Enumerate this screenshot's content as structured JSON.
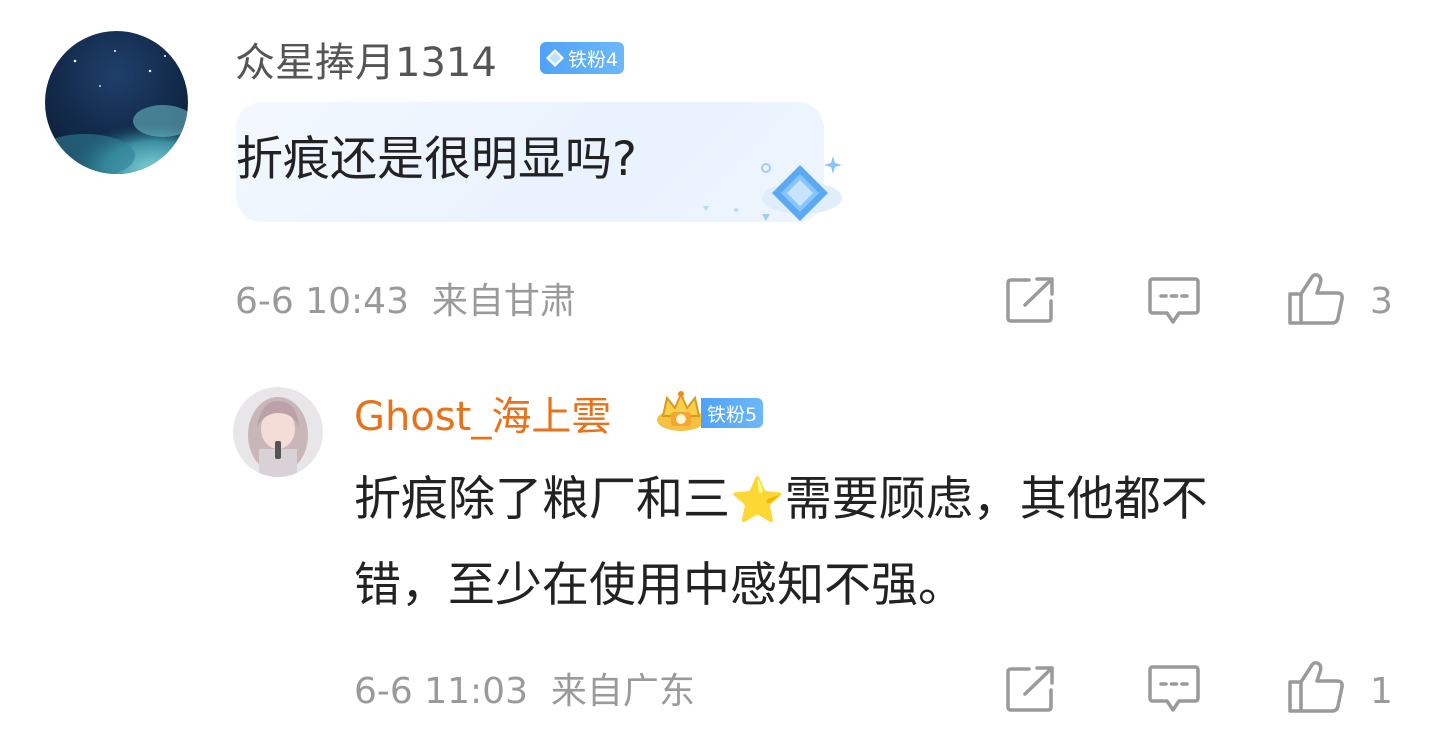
{
  "comments": [
    {
      "username": "众星捧月1314",
      "badge": "铁粉4",
      "text_line1": "折痕还是很明显吗?",
      "time": "6-6 10:43",
      "location": "来自甘肃",
      "likes": "3"
    },
    {
      "username": "Ghost_海上雲",
      "badge": "铁粉5",
      "text_line1": "折痕除了粮厂和三",
      "text_line1b": "需要顾虑，其他都不",
      "text_line2": "错，至少在使用中感知不强。",
      "emoji": "⭐",
      "time": "6-6 11:03",
      "location": "来自广东",
      "likes": "1"
    }
  ],
  "colors": {
    "username": "#555555",
    "reply_username": "#e8711a",
    "meta": "#9a9a9a",
    "badge": "#4fa2f7",
    "bubble": "#eef5fe"
  },
  "icons": {
    "share": "share-icon",
    "comment": "comment-icon",
    "like": "thumbs-up-icon",
    "crown": "crown-icon",
    "gem": "diamond-icon"
  }
}
